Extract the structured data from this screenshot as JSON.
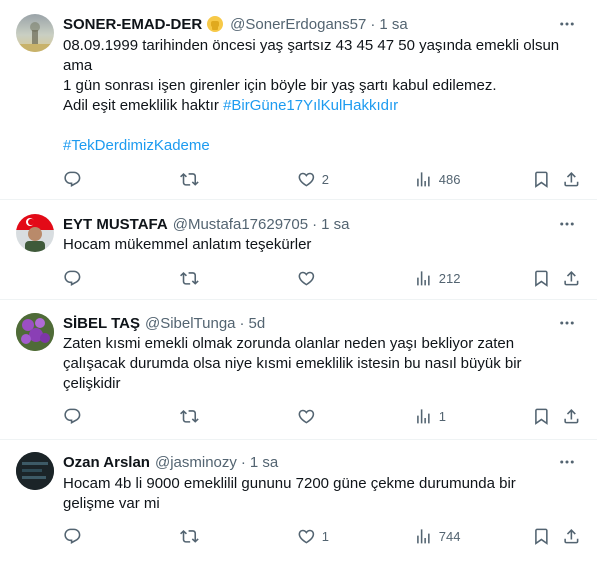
{
  "tweets": [
    {
      "name": "SONER-EMAD-DER",
      "badge": "✊",
      "handle": "@SonerErdogans57",
      "dot": "·",
      "time": "1 sa",
      "lines": [
        "08.09.1999 tarihinden  öncesi yaş şartsız 43 45 47 50 yaşında emekli olsun",
        "ama",
        "1 gün sonrası işen girenler için böyle bir yaş şartı  kabul edilemez.",
        "Adil eşit emeklilik haktır"
      ],
      "hashtag1": "#BirGüne17YılKulHakkıdır",
      "hashtag2": "#TekDerdimizKademe",
      "retweets": "",
      "likes": "2",
      "views": "486"
    },
    {
      "name": "EYT MUSTAFA",
      "handle": "@Mustafa17629705",
      "dot": "·",
      "time": "1 sa",
      "lines": [
        "Hocam mükemmel anlatım teşekürler"
      ],
      "likes": "",
      "views": "212"
    },
    {
      "name": "SİBEL TAŞ",
      "handle": "@SibelTunga",
      "dot": "·",
      "time": "5d",
      "lines": [
        "Zaten kısmi emekli olmak zorunda olanlar neden yaşı bekliyor zaten",
        "çalışacak durumda olsa niye kısmi emeklilik istesin bu nasıl büyük bir",
        "çelişkidir"
      ],
      "likes": "",
      "views": "1"
    },
    {
      "name": "Ozan Arslan",
      "handle": "@jasminozy",
      "dot": "·",
      "time": "1 sa",
      "lines": [
        "Hocam 4b li 9000 emeklilil gununu 7200 güne çekme durumunda bir",
        "gelişme var mi"
      ],
      "likes": "1",
      "views": "744"
    }
  ],
  "colors": {
    "link": "#1d9bf0",
    "muted": "#536471",
    "text": "#0f1419",
    "divider": "#eff3f4"
  }
}
